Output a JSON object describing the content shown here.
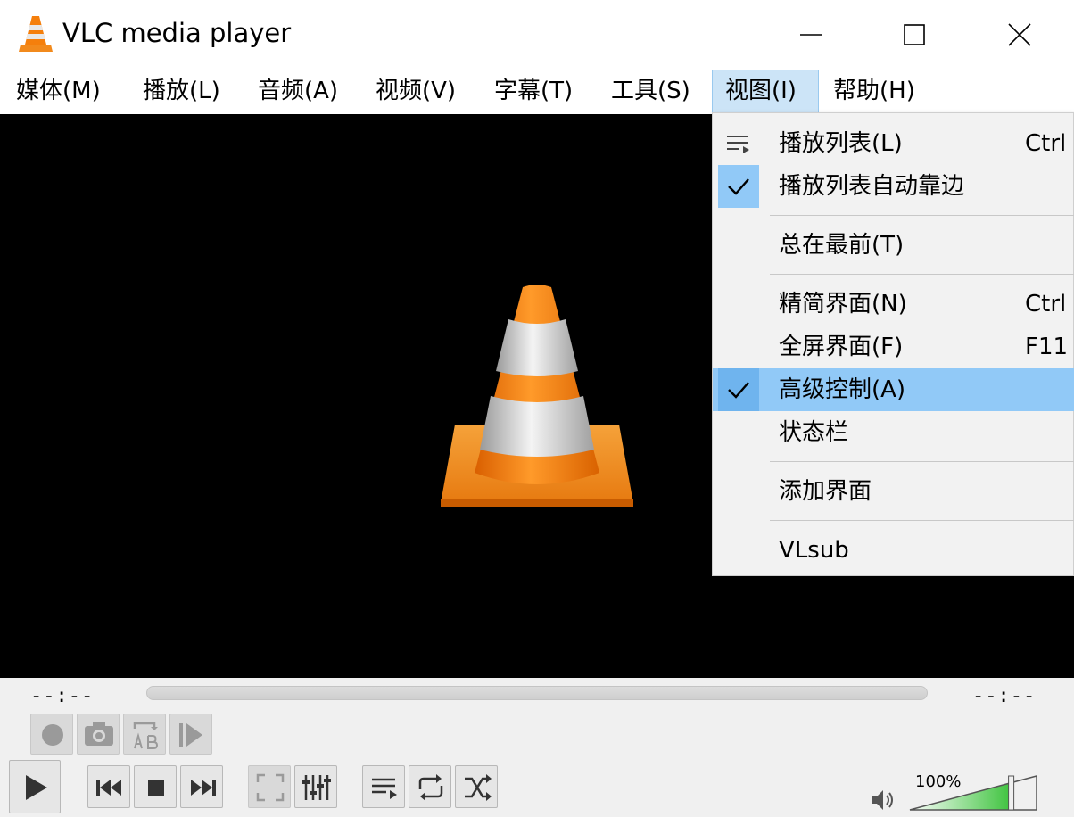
{
  "window": {
    "title": "VLC media player"
  },
  "menubar": {
    "items": [
      {
        "label": "媒体(M)"
      },
      {
        "label": "播放(L)"
      },
      {
        "label": "音频(A)"
      },
      {
        "label": "视频(V)"
      },
      {
        "label": "字幕(T)"
      },
      {
        "label": "工具(S)"
      },
      {
        "label": "视图(I)"
      },
      {
        "label": "帮助(H)"
      }
    ],
    "active_menu": "视图(I)"
  },
  "view_menu": {
    "items": [
      {
        "label": "播放列表(L)",
        "shortcut": "Ctrl",
        "icon": "playlist-icon"
      },
      {
        "label": "播放列表自动靠边",
        "checked": true
      },
      {
        "label": "总在最前(T)"
      },
      {
        "label": "精简界面(N)",
        "shortcut": "Ctrl"
      },
      {
        "label": "全屏界面(F)",
        "shortcut": "F11"
      },
      {
        "label": "高级控制(A)",
        "checked": true,
        "highlighted": true
      },
      {
        "label": "状态栏"
      },
      {
        "label": "添加界面"
      },
      {
        "label": "VLsub"
      }
    ]
  },
  "playback": {
    "elapsed": "--:--",
    "remaining": "--:--",
    "position": 0
  },
  "advanced_controls": [
    "record-icon",
    "snapshot-icon",
    "ab-loop-icon",
    "frame-step-icon"
  ],
  "main_controls": [
    "play-icon",
    "previous-icon",
    "stop-icon",
    "next-icon",
    "fullscreen-icon",
    "extended-settings-icon",
    "playlist-icon",
    "loop-icon",
    "shuffle-icon"
  ],
  "volume": {
    "label": "100%",
    "level_percent": 100,
    "icon": "speaker-icon"
  },
  "colors": {
    "menu_highlight": "#91c9f7",
    "volume_fill": "#3ec33e",
    "cone_orange": "#f57f0c"
  }
}
